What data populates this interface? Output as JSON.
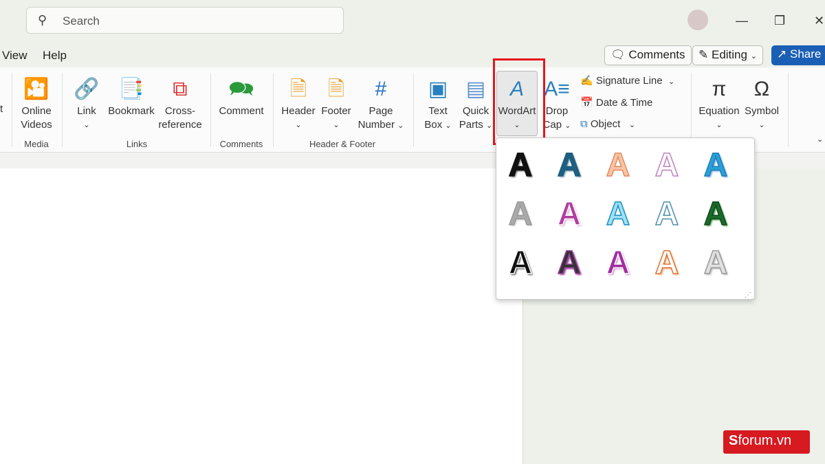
{
  "search": {
    "placeholder": "Search",
    "icon": "search-icon"
  },
  "menu_tabs": [
    "View",
    "Help"
  ],
  "top_buttons": {
    "comments": "Comments",
    "editing": "Editing",
    "share": "Share"
  },
  "ribbon": {
    "partial_label": "t",
    "online_videos": [
      "Online",
      "Videos"
    ],
    "link": "Link",
    "bookmark": "Bookmark",
    "cross_ref": [
      "Cross-",
      "reference"
    ],
    "comment": "Comment",
    "header": "Header",
    "footer": "Footer",
    "page_number": [
      "Page",
      "Number"
    ],
    "text_box": [
      "Text",
      "Box"
    ],
    "quick_parts": [
      "Quick",
      "Parts"
    ],
    "wordart": "WordArt",
    "drop_cap": [
      "Drop",
      "Cap"
    ],
    "signature_line": "Signature Line",
    "date_time": "Date & Time",
    "object": "Object",
    "equation": "Equation",
    "symbol": "Symbol",
    "groups": {
      "media": "Media",
      "links": "Links",
      "comments": "Comments",
      "header_footer": "Header & Footer"
    }
  },
  "wordart_gallery": {
    "glyph": "A",
    "styles": [
      {
        "fill": "#111111",
        "stroke": "#111111",
        "shadow": "#888888"
      },
      {
        "fill": "#1f5f7f",
        "stroke": "#1f5f7f",
        "shadow": "#9ab"
      },
      {
        "fill": "#f6c6a8",
        "stroke": "#e8875a",
        "shadow": "none"
      },
      {
        "fill": "#ffffff",
        "stroke": "#c080c0",
        "shadow": "none"
      },
      {
        "fill": "#2aa0d8",
        "stroke": "#1b7fb5",
        "shadow": "#8ad"
      },
      {
        "fill": "#aaaaaa",
        "stroke": "#999999",
        "shadow": "#ddd"
      },
      {
        "fill": "#b03fa0",
        "stroke": "#ffffff",
        "shadow": "#e0b0d8"
      },
      {
        "fill": "#9fe0f5",
        "stroke": "#1a8fc0",
        "shadow": "none"
      },
      {
        "fill": "#ffffff",
        "stroke": "#4a8fa8",
        "shadow": "none"
      },
      {
        "fill": "#1a6b2a",
        "stroke": "#0f4a1a",
        "shadow": "#6a6"
      },
      {
        "fill": "#111111",
        "stroke": "#ffffff",
        "shadow": "#555"
      },
      {
        "fill": "#333333",
        "stroke": "#a040a0",
        "shadow": "#a040a0"
      },
      {
        "fill": "#a030a0",
        "stroke": "#ffffff",
        "shadow": "#d090d0"
      },
      {
        "fill": "#ffffff",
        "stroke": "#e07030",
        "shadow": "#f0b080"
      },
      {
        "fill": "#e0e0e0",
        "stroke": "#999999",
        "shadow": "#bbb"
      }
    ]
  },
  "watermark": "forum.vn",
  "colors": {
    "accent": "#1a5fb4",
    "highlight": "#e8141b"
  }
}
